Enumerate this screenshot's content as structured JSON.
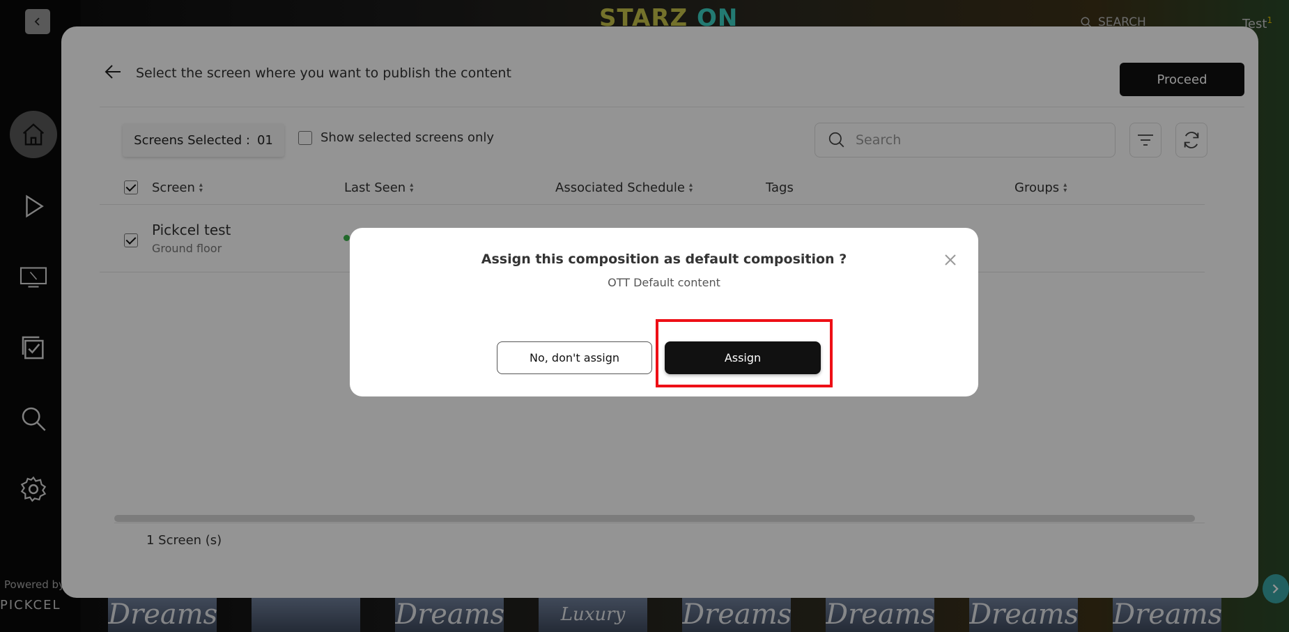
{
  "app": {
    "brand_part1": "STARZ",
    "brand_part2": "ON",
    "top_search_label": "SEARCH",
    "user_name": "Test",
    "user_badge": "1",
    "powered_by": "Powered by",
    "powered_brand": "PICKCEL",
    "thumbnail_titles": [
      "Dreams",
      "",
      "Dreams",
      "Luxury Dreams",
      "Dreams",
      "Dreams",
      "Dreams",
      "Dreams"
    ]
  },
  "nav_icons": [
    "home-icon",
    "play-icon",
    "screen-icon",
    "checklist-icon",
    "search-icon",
    "settings-icon"
  ],
  "panel": {
    "title": "Select the screen where you want to publish the content",
    "proceed_label": "Proceed",
    "screens_selected_label": "Screens Selected :",
    "screens_selected_value": "01",
    "show_selected_label": "Show selected screens only",
    "search_placeholder": "Search",
    "columns": [
      "Screen",
      "Last Seen",
      "Associated Schedule",
      "Tags",
      "Groups"
    ],
    "rows": [
      {
        "name": "Pickcel test",
        "location": "Ground floor",
        "checked": true,
        "status_color": "#3bb54a"
      }
    ],
    "footer_count": "1 Screen (s)"
  },
  "modal": {
    "title": "Assign this composition as default composition ?",
    "subtitle": "OTT Default content",
    "cancel_label": "No, don't assign",
    "confirm_label": "Assign",
    "highlight_color": "#ee0f16"
  }
}
